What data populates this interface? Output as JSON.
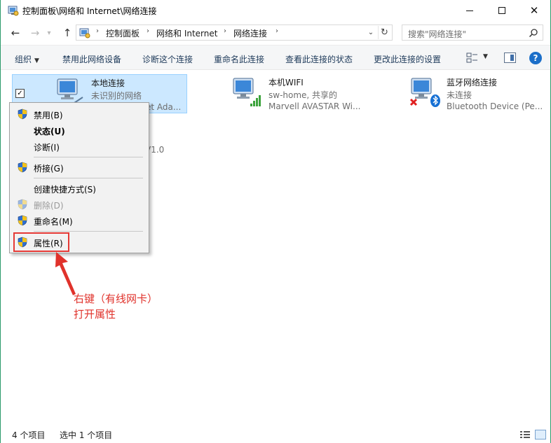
{
  "window": {
    "title": "控制面板\\网络和 Internet\\网络连接"
  },
  "address": {
    "crumbs": [
      "控制面板",
      "网络和 Internet",
      "网络连接"
    ],
    "search_placeholder": "搜索\"网络连接\""
  },
  "toolbar": {
    "organize": "组织",
    "disable_device": "禁用此网络设备",
    "diagnose": "诊断这个连接",
    "rename": "重命名此连接",
    "view_status": "查看此连接的状态",
    "change_settings": "更改此连接的设置",
    "help": "?"
  },
  "connections": [
    {
      "name": "本地连接",
      "status": "未识别的网络",
      "device": "et Ada...",
      "device_extra": "V1.0"
    },
    {
      "name": "本机WIFI",
      "status": "sw-home, 共享的",
      "device": "Marvell AVASTAR Wi..."
    },
    {
      "name": "蓝牙网络连接",
      "status": "未连接",
      "device": "Bluetooth Device (Pe..."
    }
  ],
  "context_menu": {
    "items": [
      {
        "label": "禁用(B)",
        "shield": true
      },
      {
        "label": "状态(U)",
        "bold": true
      },
      {
        "label": "诊断(I)"
      },
      {
        "label": "桥接(G)",
        "shield": true
      },
      {
        "label": "创建快捷方式(S)"
      },
      {
        "label": "删除(D)",
        "shield": true,
        "disabled": true
      },
      {
        "label": "重命名(M)",
        "shield": true
      },
      {
        "label": "属性(R)",
        "shield": true
      }
    ]
  },
  "annotation": {
    "line1": "右键（有线网卡）",
    "line2": "打开属性",
    "color": "#e0322b"
  },
  "statusbar": {
    "count": "4 个项目",
    "selected": "选中 1 个项目"
  }
}
